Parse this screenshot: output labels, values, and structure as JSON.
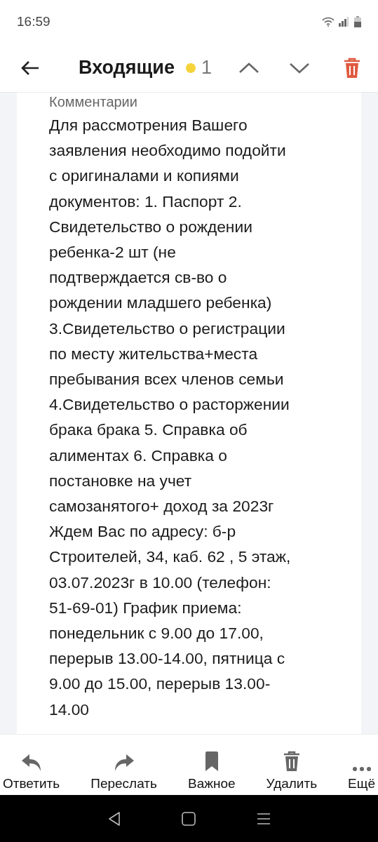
{
  "status_bar": {
    "time": "16:59"
  },
  "header": {
    "title": "Входящие",
    "unread_count": "1"
  },
  "message": {
    "section_label": "Комментарии",
    "body": "Для рассмотрения Вашего заявления необходимо подойти с оригиналами и копиями документов: 1. Паспорт 2. Свидетельство о рождении ребенка-2 шт (не подтверждается св-во о рождении младшего ребенка) 3.Свидетельство о регистрации по месту жительства+места пребывания всех членов семьи 4.Свидетельство о расторжении брака брака 5. Справка об алиментах 6. Справка о постановке на учет самозанятого+ доход за 2023г Ждем Вас по адресу: б-р Строителей, 34, каб. 62 , 5 этаж, 03.07.2023г в 10.00 (телефон: 51-69-01) График приема: понедельник с 9.00 до 17.00, перерыв 13.00-14.00, пятница с 9.00 до 15.00, перерыв 13.00-14.00"
  },
  "actions": [
    {
      "kind": "reply",
      "label": "Ответить"
    },
    {
      "kind": "forward",
      "label": "Переслать"
    },
    {
      "kind": "bookmark",
      "label": "Важное"
    },
    {
      "kind": "delete",
      "label": "Удалить"
    },
    {
      "kind": "more",
      "label": "Ещё"
    }
  ]
}
